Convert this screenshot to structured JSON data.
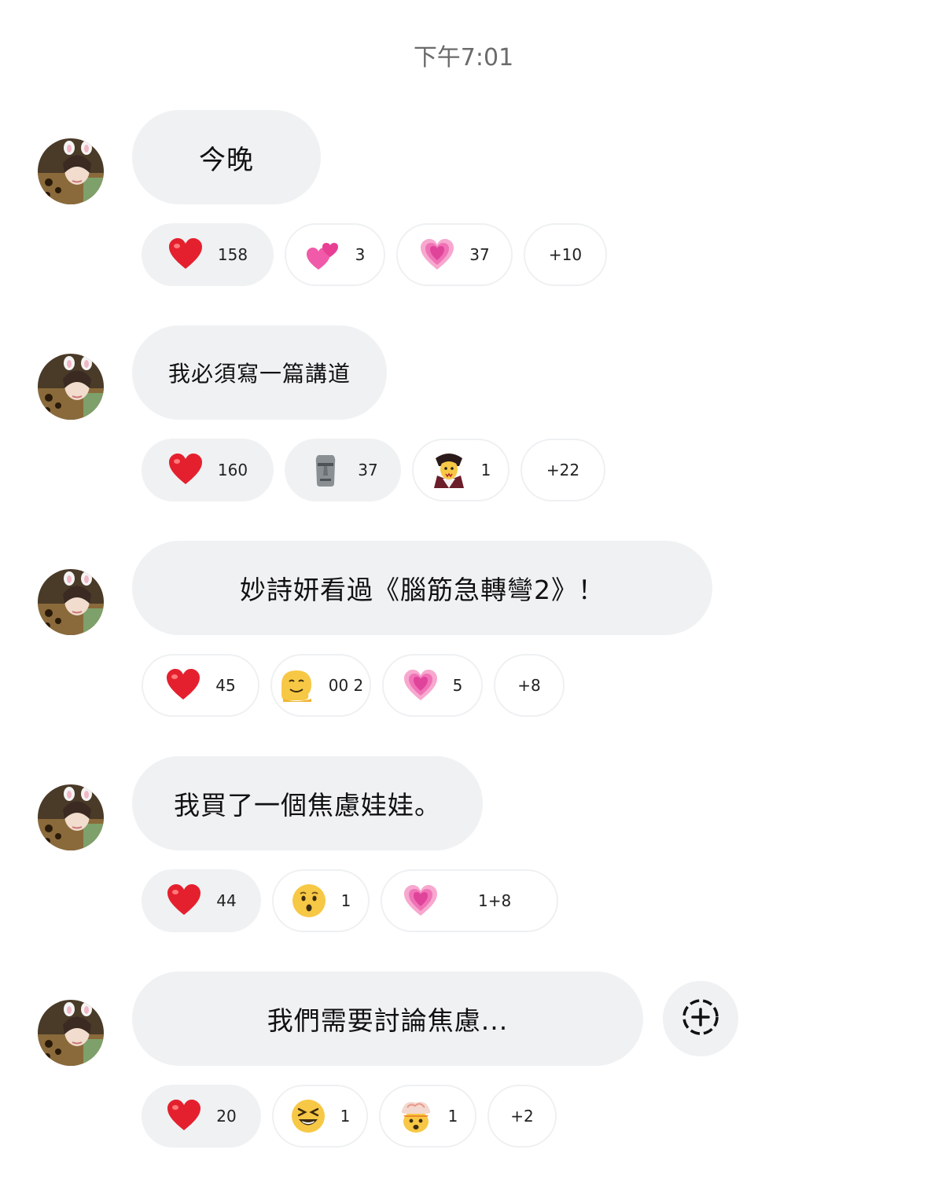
{
  "timestamp": "下午7:01",
  "messages": [
    {
      "text": "今晚",
      "reactions": [
        {
          "emoji": "red-heart-icon",
          "count": "158"
        },
        {
          "emoji": "two-hearts-icon",
          "count": "3"
        },
        {
          "emoji": "growing-heart-icon",
          "count": "37"
        },
        {
          "count": "+10"
        }
      ]
    },
    {
      "text": "我必須寫一篇講道",
      "reactions": [
        {
          "emoji": "red-heart-icon",
          "count": "160"
        },
        {
          "emoji": "moai-icon",
          "count": "37"
        },
        {
          "emoji": "vampire-icon",
          "count": "1"
        },
        {
          "count": "+22"
        }
      ]
    },
    {
      "text": "妙詩妍看過《腦筋急轉彎2》！",
      "reactions": [
        {
          "emoji": "red-heart-icon",
          "count": "45"
        },
        {
          "emoji": "melting-face-icon",
          "count": "00 2"
        },
        {
          "emoji": "growing-heart-icon",
          "count": "5"
        },
        {
          "count": "+8"
        }
      ]
    },
    {
      "text": "我買了一個焦慮娃娃。",
      "reactions": [
        {
          "emoji": "red-heart-icon",
          "count": "44"
        },
        {
          "emoji": "hushed-face-icon",
          "count": "1"
        },
        {
          "emoji": "growing-heart-icon",
          "count": "1+8"
        }
      ]
    },
    {
      "text": "我們需要討論焦慮...",
      "reactions": [
        {
          "emoji": "red-heart-icon",
          "count": "20"
        },
        {
          "emoji": "squinting-face-icon",
          "count": "1"
        },
        {
          "emoji": "exploding-head-icon",
          "count": "1"
        },
        {
          "count": "+2"
        }
      ]
    }
  ],
  "add_reaction_icon": "add-reaction-icon",
  "colors": {
    "bubble": "#eff1f3",
    "pill_border": "#eef0f2",
    "timestamp": "#6b6b6b",
    "heart": "#e5202e",
    "pink_heart": "#f05aa8"
  }
}
